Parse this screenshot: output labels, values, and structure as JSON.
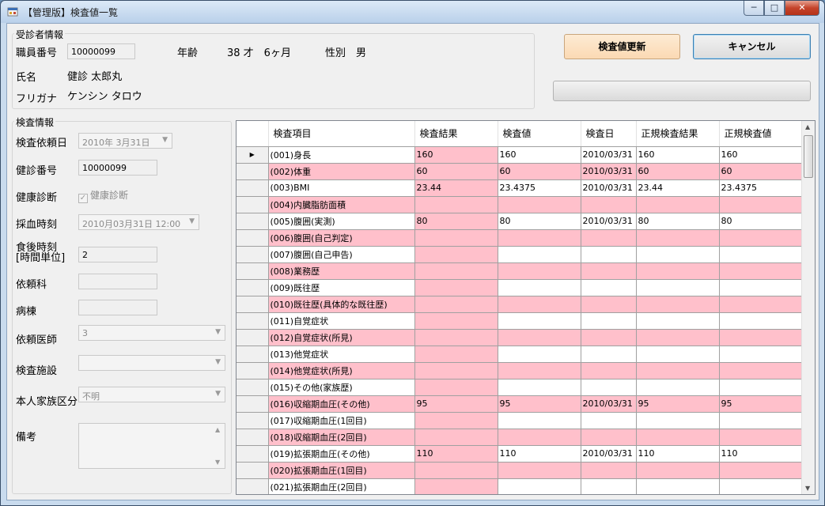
{
  "window": {
    "title": "【管理版】検査値一覧",
    "minimize_glyph": "─",
    "maximize_glyph": "□",
    "close_glyph": "✕"
  },
  "patient": {
    "group_title": "受診者情報",
    "staff_no_label": "職員番号",
    "staff_no_value": "10000099",
    "age_label": "年齢",
    "age_value": "38 才　6ヶ月",
    "sex_label": "性別",
    "sex_value": "男",
    "name_label": "氏名",
    "name_value": "健診 太郎丸",
    "kana_label": "フリガナ",
    "kana_value": "ケンシン タロウ"
  },
  "actions": {
    "update_label": "検査値更新",
    "cancel_label": "キャンセル",
    "progress": 0
  },
  "exam": {
    "group_title": "検査情報",
    "request_date_label": "検査依頼日",
    "request_date_value": "2010年  3月31日",
    "checkup_no_label": "健診番号",
    "checkup_no_value": "10000099",
    "diagnosis_label": "健康診断",
    "diagnosis_checkbox_label": "健康診断",
    "blood_time_label": "採血時刻",
    "blood_time_value": "2010月03月31日  12:00",
    "meal_label_1": "食後時刻",
    "meal_label_2": "[時間単位]",
    "meal_value": "2",
    "dept_label": "依頼科",
    "dept_value": "",
    "ward_label": "病棟",
    "ward_value": "",
    "doctor_label": "依頼医師",
    "doctor_value": "3",
    "facility_label": "検査施設",
    "facility_value": "",
    "family_label": "本人家族区分",
    "family_value": "不明",
    "remarks_label": "備考"
  },
  "grid": {
    "columns": [
      "検査項目",
      "検査結果",
      "検査値",
      "検査日",
      "正規検査結果",
      "正規検査値"
    ],
    "rows": [
      [
        "(001)身長",
        "160",
        "160",
        "2010/03/31",
        "160",
        "160"
      ],
      [
        "(002)体重",
        "60",
        "60",
        "2010/03/31",
        "60",
        "60"
      ],
      [
        "(003)BMI",
        "23.44",
        "23.4375",
        "2010/03/31",
        "23.44",
        "23.4375"
      ],
      [
        "(004)内臓脂肪面積",
        "",
        "",
        "",
        "",
        ""
      ],
      [
        "(005)腹囲(実測)",
        "80",
        "80",
        "2010/03/31",
        "80",
        "80"
      ],
      [
        "(006)腹囲(自己判定)",
        "",
        "",
        "",
        "",
        ""
      ],
      [
        "(007)腹囲(自己申告)",
        "",
        "",
        "",
        "",
        ""
      ],
      [
        "(008)業務歴",
        "",
        "",
        "",
        "",
        ""
      ],
      [
        "(009)既往歴",
        "",
        "",
        "",
        "",
        ""
      ],
      [
        "(010)既往歴(具体的な既往歴)",
        "",
        "",
        "",
        "",
        ""
      ],
      [
        "(011)自覚症状",
        "",
        "",
        "",
        "",
        ""
      ],
      [
        "(012)自覚症状(所見)",
        "",
        "",
        "",
        "",
        ""
      ],
      [
        "(013)他覚症状",
        "",
        "",
        "",
        "",
        ""
      ],
      [
        "(014)他覚症状(所見)",
        "",
        "",
        "",
        "",
        ""
      ],
      [
        "(015)その他(家族歴)",
        "",
        "",
        "",
        "",
        ""
      ],
      [
        "(016)収縮期血圧(その他)",
        "95",
        "95",
        "2010/03/31",
        "95",
        "95"
      ],
      [
        "(017)収縮期血圧(1回目)",
        "",
        "",
        "",
        "",
        ""
      ],
      [
        "(018)収縮期血圧(2回目)",
        "",
        "",
        "",
        "",
        ""
      ],
      [
        "(019)拡張期血圧(その他)",
        "110",
        "110",
        "2010/03/31",
        "110",
        "110"
      ],
      [
        "(020)拡張期血圧(1回目)",
        "",
        "",
        "",
        "",
        ""
      ],
      [
        "(021)拡張期血圧(2回目)",
        "",
        "",
        "",
        "",
        ""
      ]
    ],
    "current_row_marker": "▶"
  }
}
